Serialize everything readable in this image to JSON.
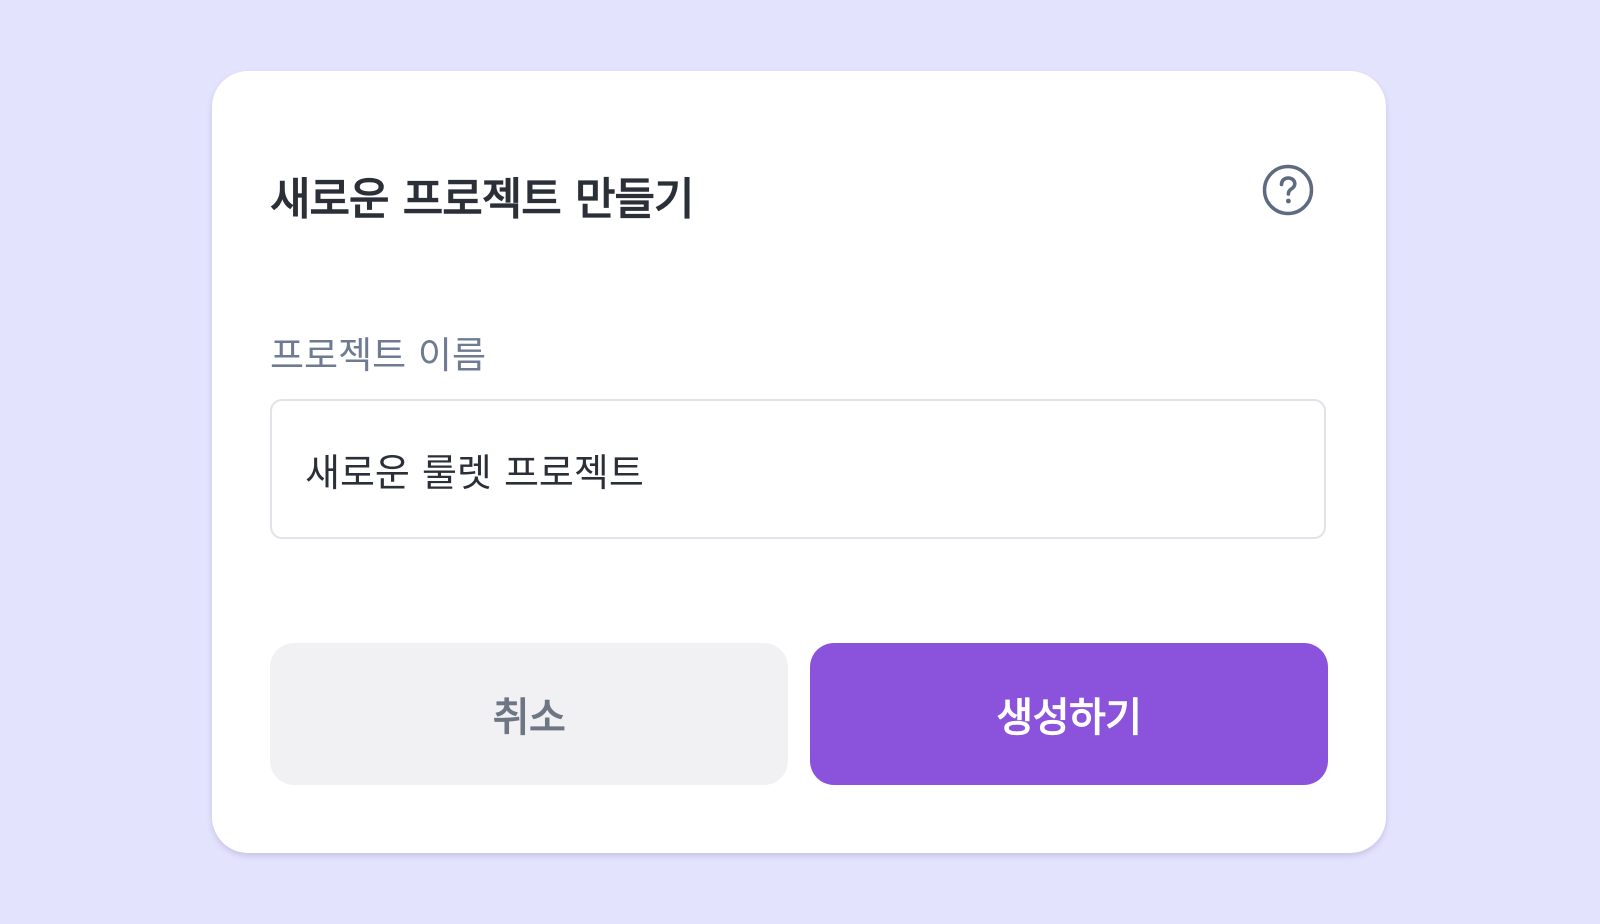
{
  "dialog": {
    "title": "새로운 프로젝트 만들기",
    "help_icon": "question-circle-icon",
    "field": {
      "label": "프로젝트 이름",
      "value": "새로운 룰렛 프로젝트"
    },
    "buttons": {
      "cancel_label": "취소",
      "create_label": "생성하기"
    }
  },
  "colors": {
    "background": "#e4e3fe",
    "dialog": "#ffffff",
    "primary": "#8b52dc",
    "cancel_bg": "#f1f1f3",
    "title_text": "#2a2f38",
    "label_text": "#6f7b92",
    "help_icon": "#5d6a80"
  }
}
